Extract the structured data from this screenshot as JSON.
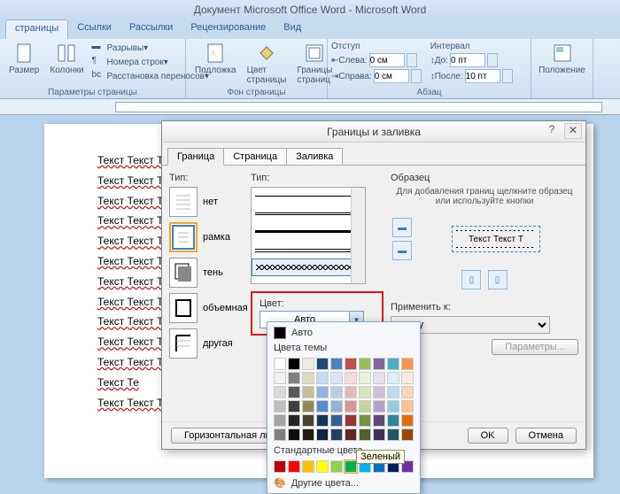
{
  "titlebar": "Документ Microsoft Office Word - Microsoft Word",
  "ribbon_tabs": [
    "страницы",
    "Ссылки",
    "Рассылки",
    "Рецензирование",
    "Вид"
  ],
  "ribbon": {
    "pagesetup": {
      "size": "Размер",
      "columns": "Колонки",
      "breaks": "Разрывы",
      "linenum": "Номера строк",
      "hyphen": "Расстановка переносов",
      "label": "Параметры страницы"
    },
    "background": {
      "watermark": "Подложка",
      "pagecolor": "Цвет\nстраницы",
      "borders": "Границы\nстраниц",
      "label": "Фон страницы"
    },
    "paragraph": {
      "indent_label": "Отступ",
      "left": "Слева:",
      "right": "Справа:",
      "left_val": "0 см",
      "right_val": "0 см",
      "spacing_label": "Интервал",
      "before": "До:",
      "after": "После:",
      "before_val": "0 пт",
      "after_val": "10 пт",
      "label": "Абзац"
    },
    "position": "Положение"
  },
  "page_text_line": "Текст Текст Текст Текст Текст Текст Текст Текст Текст Текст Текст Текст",
  "page_text_short": "Текст Те",
  "dialog": {
    "title": "Границы и заливка",
    "tabs": [
      "Граница",
      "Страница",
      "Заливка"
    ],
    "type_label": "Тип:",
    "settings": [
      {
        "key": "none",
        "label": "нет"
      },
      {
        "key": "box",
        "label": "рамка"
      },
      {
        "key": "shadow",
        "label": "тень"
      },
      {
        "key": "threeD",
        "label": "объемная"
      },
      {
        "key": "custom",
        "label": "другая"
      }
    ],
    "style_label": "Тип:",
    "color_label": "Цвет:",
    "color_value": "Авто",
    "preview_label": "Образец",
    "preview_hint": "Для добавления границ щелкните образец или используйте кнопки",
    "preview_text": "Текст Текст Т",
    "apply_label": "Применить к:",
    "apply_value": "тексту",
    "params": "Параметры...",
    "hline": "Горизонтальная линия...",
    "ok": "OK",
    "cancel": "Отмена"
  },
  "color_popup": {
    "auto": "Авто",
    "theme": "Цвета темы",
    "theme_colors": [
      [
        "#ffffff",
        "#000000",
        "#eeece1",
        "#1f497d",
        "#4f81bd",
        "#c0504d",
        "#9bbb59",
        "#8064a2",
        "#4bacc6",
        "#f79646"
      ],
      [
        "#f2f2f2",
        "#7f7f7f",
        "#ddd9c3",
        "#c6d9f0",
        "#dbe5f1",
        "#f2dcdb",
        "#ebf1dd",
        "#e5e0ec",
        "#dbeef3",
        "#fdeada"
      ],
      [
        "#d8d8d8",
        "#595959",
        "#c4bd97",
        "#8db3e2",
        "#b8cce4",
        "#e5b9b7",
        "#d7e3bc",
        "#ccc1d9",
        "#b7dde8",
        "#fbd5b5"
      ],
      [
        "#bfbfbf",
        "#3f3f3f",
        "#938953",
        "#548dd4",
        "#95b3d7",
        "#d99694",
        "#c3d69b",
        "#b2a2c7",
        "#92cddc",
        "#fac08f"
      ],
      [
        "#a5a5a5",
        "#262626",
        "#494429",
        "#17365d",
        "#366092",
        "#953734",
        "#76923c",
        "#5f497a",
        "#31859b",
        "#e36c09"
      ],
      [
        "#7f7f7f",
        "#0c0c0c",
        "#1d1b10",
        "#0f243e",
        "#244061",
        "#632423",
        "#4f6128",
        "#3f3151",
        "#205867",
        "#974806"
      ]
    ],
    "standard": "Стандартные цвета",
    "standard_colors": [
      "#c00000",
      "#ff0000",
      "#ffc000",
      "#ffff00",
      "#92d050",
      "#00b050",
      "#00b0f0",
      "#0070c0",
      "#002060",
      "#7030a0"
    ],
    "other": "Другие цвета...",
    "tooltip": "Зеленый"
  }
}
